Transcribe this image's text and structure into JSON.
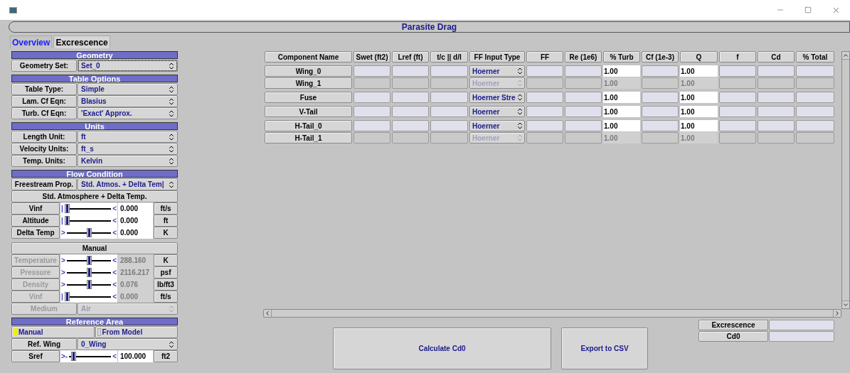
{
  "window": {
    "title": "Parasite Drag"
  },
  "tabs": [
    {
      "label": "Overview",
      "selected": true
    },
    {
      "label": "Excrescence",
      "selected": false
    }
  ],
  "sections": [
    {
      "title": "Geometry",
      "groups": [
        [
          {
            "kind": "choice",
            "label": "Geometry Set:",
            "value": "Set_0",
            "focused": true,
            "disabled": false
          }
        ]
      ]
    },
    {
      "title": "Table Options",
      "groups": [
        [
          {
            "kind": "choice",
            "label": "Table Type:",
            "value": "Simple",
            "focused": false,
            "disabled": false
          },
          {
            "kind": "choice",
            "label": "Lam. Cf Eqn:",
            "value": "Blasius",
            "focused": false,
            "disabled": false
          },
          {
            "kind": "choice",
            "label": "Turb. Cf Eqn:",
            "value": "'Exact' Approx.",
            "focused": false,
            "disabled": false
          }
        ]
      ]
    },
    {
      "title": "Units",
      "groups": [
        [
          {
            "kind": "choice",
            "label": "Length Unit:",
            "value": "ft",
            "focused": false,
            "disabled": false
          },
          {
            "kind": "choice",
            "label": "Velocity Units:",
            "value": "ft_s",
            "focused": false,
            "disabled": false
          },
          {
            "kind": "choice",
            "label": "Temp. Units:",
            "value": "Kelvin",
            "focused": false,
            "disabled": false
          }
        ]
      ]
    },
    {
      "title": "Flow Condition",
      "groups": [
        [
          {
            "kind": "choice",
            "label": "Freestream Prop.",
            "value": "Std. Atmos. + Delta Tem|",
            "focused": false,
            "disabled": false
          },
          {
            "kind": "heading",
            "label": "Std. Atmosphere + Delta Temp."
          },
          {
            "kind": "slider",
            "label": "Vinf",
            "low": "|",
            "high": "<",
            "level": 0,
            "value": "0.000",
            "unit": "ft/s",
            "disabled": false
          },
          {
            "kind": "slider",
            "label": "Altitude",
            "low": "|",
            "high": "<",
            "level": 0,
            "value": "0.000",
            "unit": "ft",
            "disabled": false
          },
          {
            "kind": "slider",
            "label": "Delta Temp",
            "low": ">",
            "high": "<",
            "level": 0.5,
            "value": "0.000",
            "unit": "K",
            "disabled": false
          }
        ],
        [
          {
            "kind": "heading",
            "label": "Manual"
          },
          {
            "kind": "slider",
            "label": "Temperature",
            "low": ">",
            "high": "<",
            "level": 0.5,
            "value": "288.160",
            "unit": "K",
            "disabled": true
          },
          {
            "kind": "slider",
            "label": "Pressure",
            "low": ">",
            "high": "<",
            "level": 0.5,
            "value": "2116.217",
            "unit": "psf",
            "disabled": true
          },
          {
            "kind": "slider",
            "label": "Density",
            "low": ">",
            "high": "<",
            "level": 0.5,
            "value": "0.076",
            "unit": "lb/ft3",
            "disabled": true
          },
          {
            "kind": "slider",
            "label": "Vinf",
            "low": "|",
            "high": "<",
            "level": 0,
            "value": "0.000",
            "unit": "ft/s",
            "disabled": true
          },
          {
            "kind": "choice",
            "label": "Medium",
            "value": "Air",
            "focused": false,
            "disabled": true
          }
        ]
      ]
    },
    {
      "title": "Reference Area",
      "groups": [
        [
          {
            "kind": "toggle",
            "options": [
              {
                "label": "Manual",
                "selected": true
              },
              {
                "label": "From Model",
                "selected": false
              }
            ]
          },
          {
            "kind": "choice",
            "label": "Ref. Wing",
            "value": "0_Wing",
            "focused": false,
            "disabled": false
          },
          {
            "kind": "slider",
            "label": "Sref",
            "low": ">-",
            "high": "<",
            "level": 0.05,
            "value": "100.000",
            "unit": "ft2",
            "disabled": false
          }
        ]
      ]
    }
  ],
  "table": {
    "columns": [
      "Component Name",
      "Swet (ft2)",
      "Lref (ft)",
      "t/c || d/l",
      "FF Input Type",
      "FF",
      "Re (1e6)",
      "% Turb",
      "Cf (1e-3)",
      "Q",
      "f",
      "Cd",
      "% Total"
    ],
    "row_groups": [
      [
        {
          "name": "Wing_0",
          "disabled": false,
          "ff_input": "Hoerner",
          "turb": "1.00",
          "q": "1.00"
        },
        {
          "name": "Wing_1",
          "disabled": true,
          "ff_input": "Hoerner",
          "turb": "1.00",
          "q": "1.00"
        }
      ],
      [
        {
          "name": "Fuse",
          "disabled": false,
          "ff_input": "Hoerner Stre",
          "turb": "1.00",
          "q": "1.00"
        }
      ],
      [
        {
          "name": "V-Tail",
          "disabled": false,
          "ff_input": "Hoerner",
          "turb": "1.00",
          "q": "1.00"
        }
      ],
      [
        {
          "name": "H-Tail_0",
          "disabled": false,
          "ff_input": "Hoerner",
          "turb": "1.00",
          "q": "1.00"
        },
        {
          "name": "H-Tail_1",
          "disabled": true,
          "ff_input": "Hoerner",
          "turb": "1.00",
          "q": "1.00"
        }
      ]
    ]
  },
  "buttons": [
    "Calculate Cd0",
    "Export to CSV"
  ],
  "results": [
    {
      "label": "Excrescence"
    },
    {
      "label": "Cd0"
    }
  ]
}
